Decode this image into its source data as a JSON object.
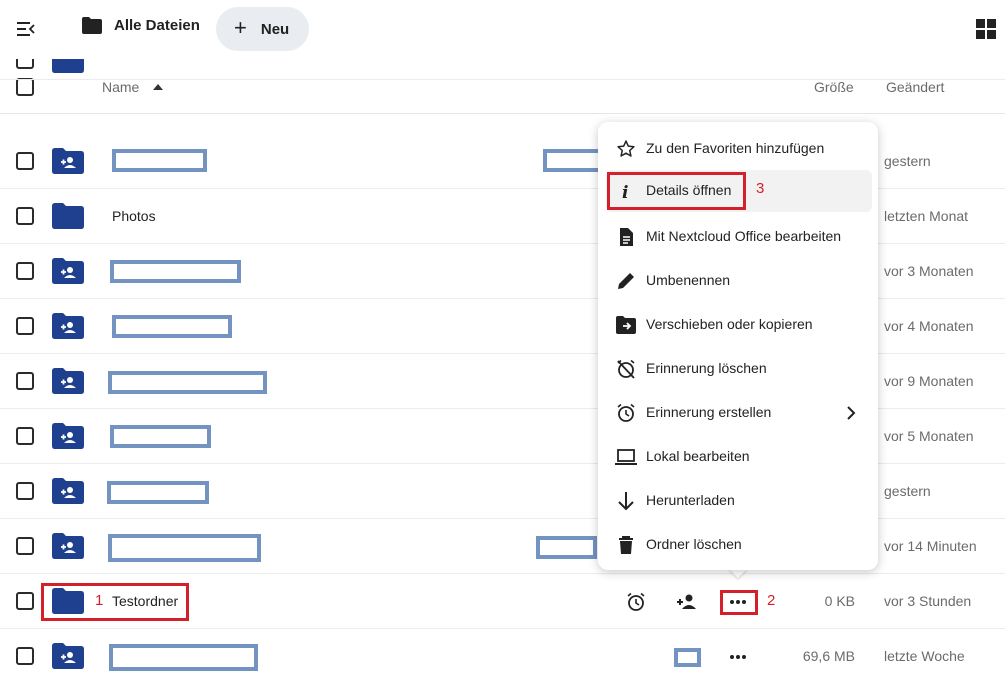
{
  "toolbar": {
    "breadcrumb_label": "Alle Dateien",
    "new_button_label": "Neu",
    "new_button_glyph": "+"
  },
  "table_header": {
    "name": "Name",
    "size": "Größe",
    "modified": "Geändert"
  },
  "rows": [
    {
      "type": "shared-folder",
      "name": "",
      "modified": "gestern",
      "size": ""
    },
    {
      "type": "folder",
      "name": "Photos",
      "modified": "letzten Monat",
      "size": ""
    },
    {
      "type": "shared-folder",
      "name": "",
      "modified": "vor 3 Monaten",
      "size": ""
    },
    {
      "type": "shared-folder",
      "name": "",
      "modified": "vor 4 Monaten",
      "size": ""
    },
    {
      "type": "shared-folder",
      "name": "",
      "modified": "vor 9 Monaten",
      "size": ""
    },
    {
      "type": "shared-folder",
      "name": "",
      "modified": "vor 5 Monaten",
      "size": ""
    },
    {
      "type": "shared-folder",
      "name": "",
      "modified": "gestern",
      "size": ""
    },
    {
      "type": "shared-folder",
      "name": "",
      "modified": "vor 14 Minuten",
      "size": ""
    },
    {
      "type": "folder",
      "name": "Testordner",
      "modified": "vor 3 Stunden",
      "size": "0 KB",
      "marker": "1",
      "actions_marker": "2"
    },
    {
      "type": "shared-folder",
      "name": "",
      "modified": "letzte Woche",
      "size": "69,6 MB"
    }
  ],
  "context_menu": {
    "items": [
      {
        "label": "Zu den Favoriten hinzufügen",
        "icon": "star-outline-icon"
      },
      {
        "label": "Details öffnen",
        "icon": "info-icon",
        "marker": "3"
      },
      {
        "label": "Mit Nextcloud Office bearbeiten",
        "icon": "document-icon"
      },
      {
        "label": "Umbenennen",
        "icon": "pencil-icon"
      },
      {
        "label": "Verschieben oder kopieren",
        "icon": "folder-move-icon"
      },
      {
        "label": "Erinnerung löschen",
        "icon": "alarm-off-icon"
      },
      {
        "label": "Erinnerung erstellen",
        "icon": "alarm-icon"
      },
      {
        "label": "Lokal bearbeiten",
        "icon": "laptop-icon"
      },
      {
        "label": "Herunterladen",
        "icon": "download-arrow-icon"
      },
      {
        "label": "Ordner löschen",
        "icon": "trash-icon"
      }
    ]
  },
  "colors": {
    "folder": "#1f3f8f",
    "highlight": "#d4202a",
    "redaction": "#7393c0"
  }
}
